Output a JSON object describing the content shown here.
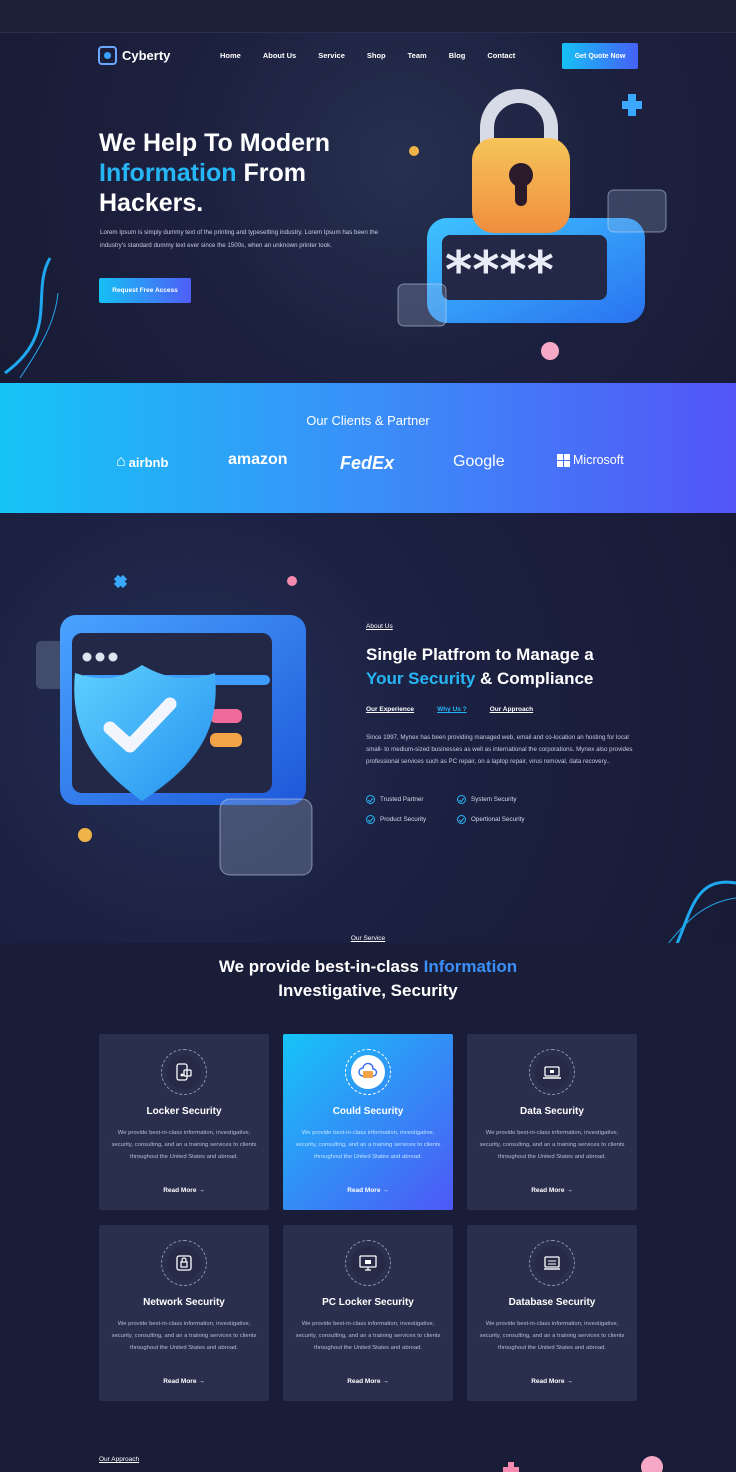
{
  "brand": {
    "name": "Cyberty"
  },
  "nav": {
    "items": [
      "Home",
      "About Us",
      "Service",
      "Shop",
      "Team",
      "Blog",
      "Contact"
    ],
    "cta": "Get Quote Now"
  },
  "hero": {
    "title_line1": "We Help To Modern",
    "title_accent": "Information",
    "title_rest": " From",
    "title_line3": "Hackers.",
    "text": "Lorem Ipsum is simply dummy text of the printing and typesetting industry. Lorem Ipsum has been the industry's standard dummy text ever since the 1500s, when an unknown printer took.",
    "button": "Request Free Access",
    "password_mask": "****"
  },
  "clients": {
    "title": "Our Clients & Partner",
    "logos": [
      "airbnb",
      "amazon",
      "FedEx",
      "Google",
      "Microsoft"
    ]
  },
  "about": {
    "label": "About Us",
    "title_line1": "Single Platfrom to Manage a",
    "title_accent": "Your Security",
    "title_rest": " & Compliance",
    "tabs": [
      "Our Experience",
      "Why Us ?",
      "Our Approach"
    ],
    "active_tab": "Why Us ?",
    "text": "Since 1997, Mynex has been providing managed web, email and co-location an hosting for local small- to medium-sized businesses as well as international the corporations. Mynex also provides professional services such as PC repair, on a laptop repair, virus removal, data recovery..",
    "features": [
      "Trusted Partner",
      "System Security",
      "Product Security",
      "Opertional Security"
    ]
  },
  "services": {
    "label": "Our Service",
    "title_pre": "We provide best-in-class ",
    "title_accent": "Information",
    "title_line2": "Investigative, Security",
    "cards": [
      {
        "title": "Locker Security",
        "text": "We provide best-in-class information, investigative, security, consulting, and an a training services to clients throughout the United States and abroad.",
        "link": "Read More",
        "icon": "locker-icon",
        "highlight": false
      },
      {
        "title": "Could Security",
        "text": "We provide best-in-class information, investigative, security, consulting, and an a training services to clients throughout the United States and abroad.",
        "link": "Read More",
        "icon": "cloud-card-icon",
        "highlight": true
      },
      {
        "title": "Data Security",
        "text": "We provide best-in-class information, investigative, security, consulting, and an a training services to clients throughout the United States and abroad.",
        "link": "Read More",
        "icon": "laptop-lock-icon",
        "highlight": false
      },
      {
        "title": "Network Security",
        "text": "We provide best-in-class information, investigative, security, consulting, and an a training services to clients throughout the United States and abroad.",
        "link": "Read More",
        "icon": "network-lock-icon",
        "highlight": false
      },
      {
        "title": "PC Locker Security",
        "text": "We provide best-in-class information, investigative, security, consulting, and an a training services to clients throughout the United States and abroad.",
        "link": "Read More",
        "icon": "pc-lock-icon",
        "highlight": false
      },
      {
        "title": "Database Security",
        "text": "We provide best-in-class information, investigative, security, consulting, and an a training services to clients throughout the United States and abroad.",
        "link": "Read More",
        "icon": "database-lock-icon",
        "highlight": false
      }
    ]
  },
  "approach": {
    "label": "Our Approach"
  },
  "colors": {
    "accent": "#26b6f6",
    "gradient_start": "#16c4f7",
    "gradient_end": "#5355f7",
    "background": "#1a1e3a"
  }
}
